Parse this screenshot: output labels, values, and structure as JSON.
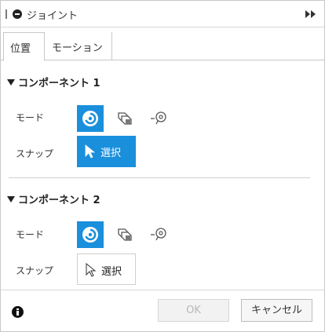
{
  "window": {
    "title": "ジョイント",
    "collapse_icon": "double-chevron-right-icon"
  },
  "tabs": [
    {
      "label": "位置",
      "active": true
    },
    {
      "label": "モーション",
      "active": false
    }
  ],
  "sections": [
    {
      "header": "コンポーネント 1",
      "mode_label": "モード",
      "snap_label": "スナップ",
      "snap_button_label": "選択",
      "snap_active": true
    },
    {
      "header": "コンポーネント 2",
      "mode_label": "モード",
      "snap_label": "スナップ",
      "snap_button_label": "選択",
      "snap_active": false
    }
  ],
  "footer": {
    "ok_label": "OK",
    "cancel_label": "キャンセル"
  },
  "colors": {
    "accent": "#1a8fdc",
    "border": "#c8c8c8"
  }
}
